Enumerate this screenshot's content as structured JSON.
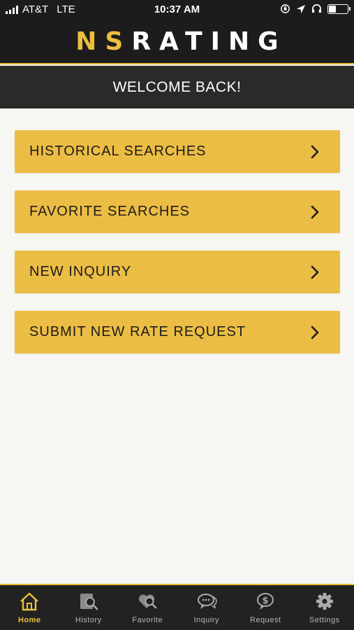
{
  "status": {
    "carrier": "AT&T",
    "network": "LTE",
    "time": "10:37 AM",
    "battery_level": 0.35
  },
  "header": {
    "logo_part1": "NS",
    "logo_part2": "RATING",
    "welcome": "WELCOME BACK!"
  },
  "menu": [
    {
      "label": "HISTORICAL SEARCHES",
      "icon": "chevron-right-icon"
    },
    {
      "label": "FAVORITE SEARCHES",
      "icon": "chevron-right-icon"
    },
    {
      "label": "NEW INQUIRY",
      "icon": "chevron-right-icon"
    },
    {
      "label": "SUBMIT NEW RATE REQUEST",
      "icon": "chevron-right-icon"
    }
  ],
  "tabs": [
    {
      "label": "Home",
      "icon": "home-icon",
      "active": true
    },
    {
      "label": "History",
      "icon": "history-search-icon",
      "active": false
    },
    {
      "label": "Favorite",
      "icon": "heart-search-icon",
      "active": false
    },
    {
      "label": "Inquiry",
      "icon": "chat-bubbles-icon",
      "active": false
    },
    {
      "label": "Request",
      "icon": "dollar-bubble-icon",
      "active": false
    },
    {
      "label": "Settings",
      "icon": "gear-icon",
      "active": false
    }
  ],
  "colors": {
    "accent": "#ecbd44",
    "dark": "#1c1c1c",
    "background": "#f6f6f2",
    "tab_inactive": "#b8b8b8"
  }
}
